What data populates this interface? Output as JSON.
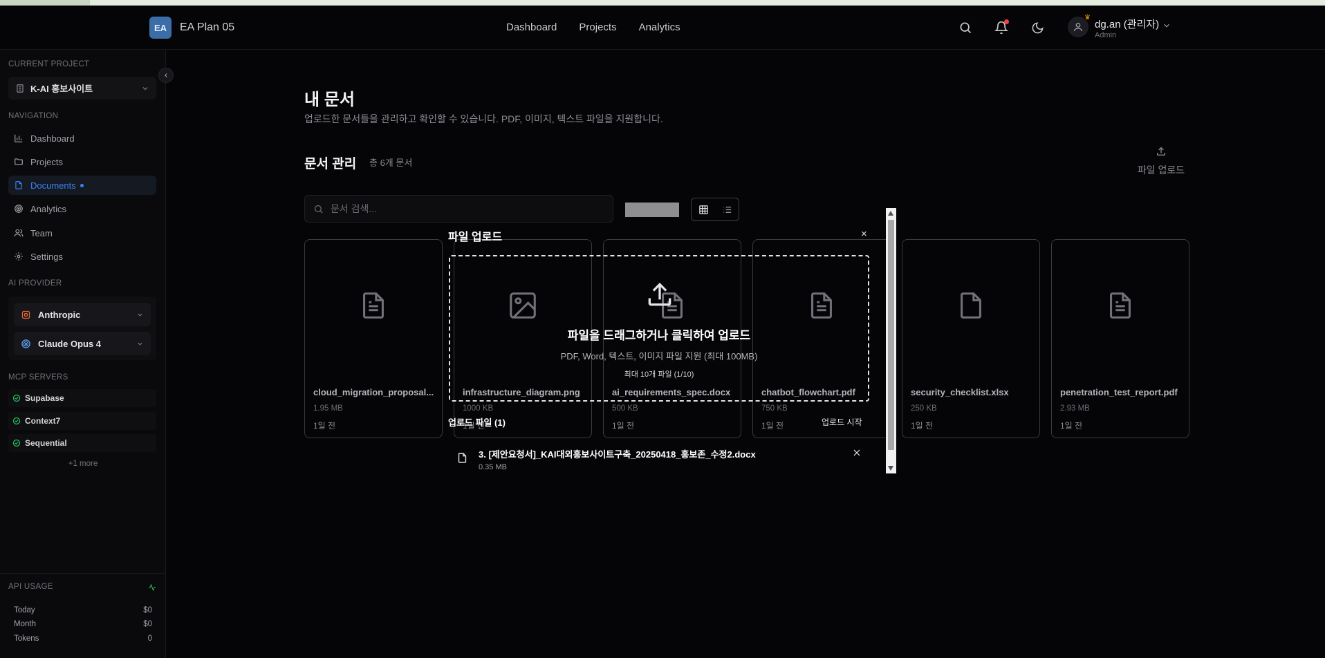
{
  "header": {
    "logo_text": "EA",
    "app_name": "EA Plan 05",
    "nav": [
      "Dashboard",
      "Projects",
      "Analytics"
    ],
    "user_name": "dg.an (관리자)",
    "user_role": "Admin"
  },
  "sidebar": {
    "current_project_label": "CURRENT PROJECT",
    "current_project": "K-AI 홍보사이트",
    "navigation_label": "NAVIGATION",
    "nav_items": [
      {
        "label": "Dashboard",
        "icon": "bar-chart-icon"
      },
      {
        "label": "Projects",
        "icon": "folder-icon"
      },
      {
        "label": "Documents",
        "icon": "file-icon",
        "active": true
      },
      {
        "label": "Analytics",
        "icon": "target-icon"
      },
      {
        "label": "Team",
        "icon": "users-icon"
      },
      {
        "label": "Settings",
        "icon": "gear-icon"
      }
    ],
    "ai_provider_label": "AI PROVIDER",
    "ai_provider": "Anthropic",
    "ai_model": "Claude Opus 4",
    "mcp_label": "MCP SERVERS",
    "mcp_servers": [
      "Supabase",
      "Context7",
      "Sequential"
    ],
    "mcp_more": "+1 more",
    "api_usage_label": "API USAGE",
    "usage": [
      {
        "label": "Today",
        "value": "$0"
      },
      {
        "label": "Month",
        "value": "$0"
      },
      {
        "label": "Tokens",
        "value": "0"
      }
    ]
  },
  "main": {
    "title": "내 문서",
    "subtitle": "업로드한 문서들을 관리하고 확인할 수 있습니다. PDF, 이미지, 텍스트 파일을 지원합니다.",
    "section_title": "문서 관리",
    "doc_count": "총 6개 문서",
    "upload_button": "파일 업로드",
    "search_placeholder": "문서 검색...",
    "documents": [
      {
        "name": "cloud_migration_proposal...",
        "size": "1.95 MB",
        "date": "1일 전",
        "icon": "document-icon"
      },
      {
        "name": "infrastructure_diagram.png",
        "size": "1000 KB",
        "date": "1일 전",
        "icon": "image-icon"
      },
      {
        "name": "ai_requirements_spec.docx",
        "size": "500 KB",
        "date": "1일 전",
        "icon": "document-icon"
      },
      {
        "name": "chatbot_flowchart.pdf",
        "size": "750 KB",
        "date": "1일 전",
        "icon": "document-icon"
      },
      {
        "name": "security_checklist.xlsx",
        "size": "250 KB",
        "date": "1일 전",
        "icon": "blank-file-icon"
      },
      {
        "name": "penetration_test_report.pdf",
        "size": "2.93 MB",
        "date": "1일 전",
        "icon": "document-icon"
      }
    ]
  },
  "upload_modal": {
    "title": "파일 업로드",
    "close": "×",
    "drop_title": "파일을 드래그하거나 클릭하여 업로드",
    "drop_sub": "PDF, Word, 텍스트, 이미지 파일 지원 (최대 100MB)",
    "drop_max": "최대 10개 파일 (1/10)",
    "files_label": "업로드 파일 (1)",
    "start_button": "업로드 시작",
    "files": [
      {
        "name": "3. [제안요청서]_KAI대외홍보사이트구축_20250418_홍보존_수정2.docx",
        "size": "0.35 MB"
      }
    ]
  },
  "colors": {
    "accent": "#3b82f6",
    "background": "#050507",
    "notification": "#ef4444",
    "anthropic": "#e5693b"
  }
}
